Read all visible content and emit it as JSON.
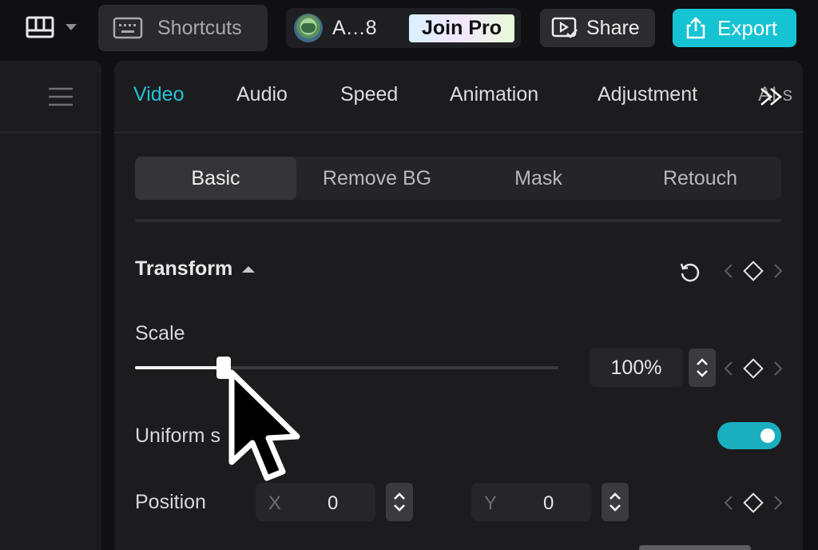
{
  "toolbar": {
    "layout_icon": "layout-grid-icon",
    "shortcuts_label": "Shortcuts",
    "account_name": "A…8",
    "join_pro_label": "Join Pro",
    "share_label": "Share",
    "export_label": "Export",
    "export_color": "#16c3d3"
  },
  "tabs": [
    {
      "label": "Video",
      "active": true
    },
    {
      "label": "Audio"
    },
    {
      "label": "Speed"
    },
    {
      "label": "Animation"
    },
    {
      "label": "Adjustment"
    },
    {
      "label": "AI s"
    }
  ],
  "subtabs": [
    {
      "label": "Basic",
      "active": true
    },
    {
      "label": "Remove BG"
    },
    {
      "label": "Mask"
    },
    {
      "label": "Retouch"
    }
  ],
  "transform": {
    "title": "Transform",
    "scale_label": "Scale",
    "scale_value": "100%",
    "scale_slider_fraction": 0.21,
    "uniform_label": "Uniform s",
    "uniform_enabled": true,
    "position_label": "Position",
    "x_axis": "X",
    "x_value": "0",
    "y_axis": "Y",
    "y_value": "0"
  },
  "accent_color": "#22c3d6"
}
